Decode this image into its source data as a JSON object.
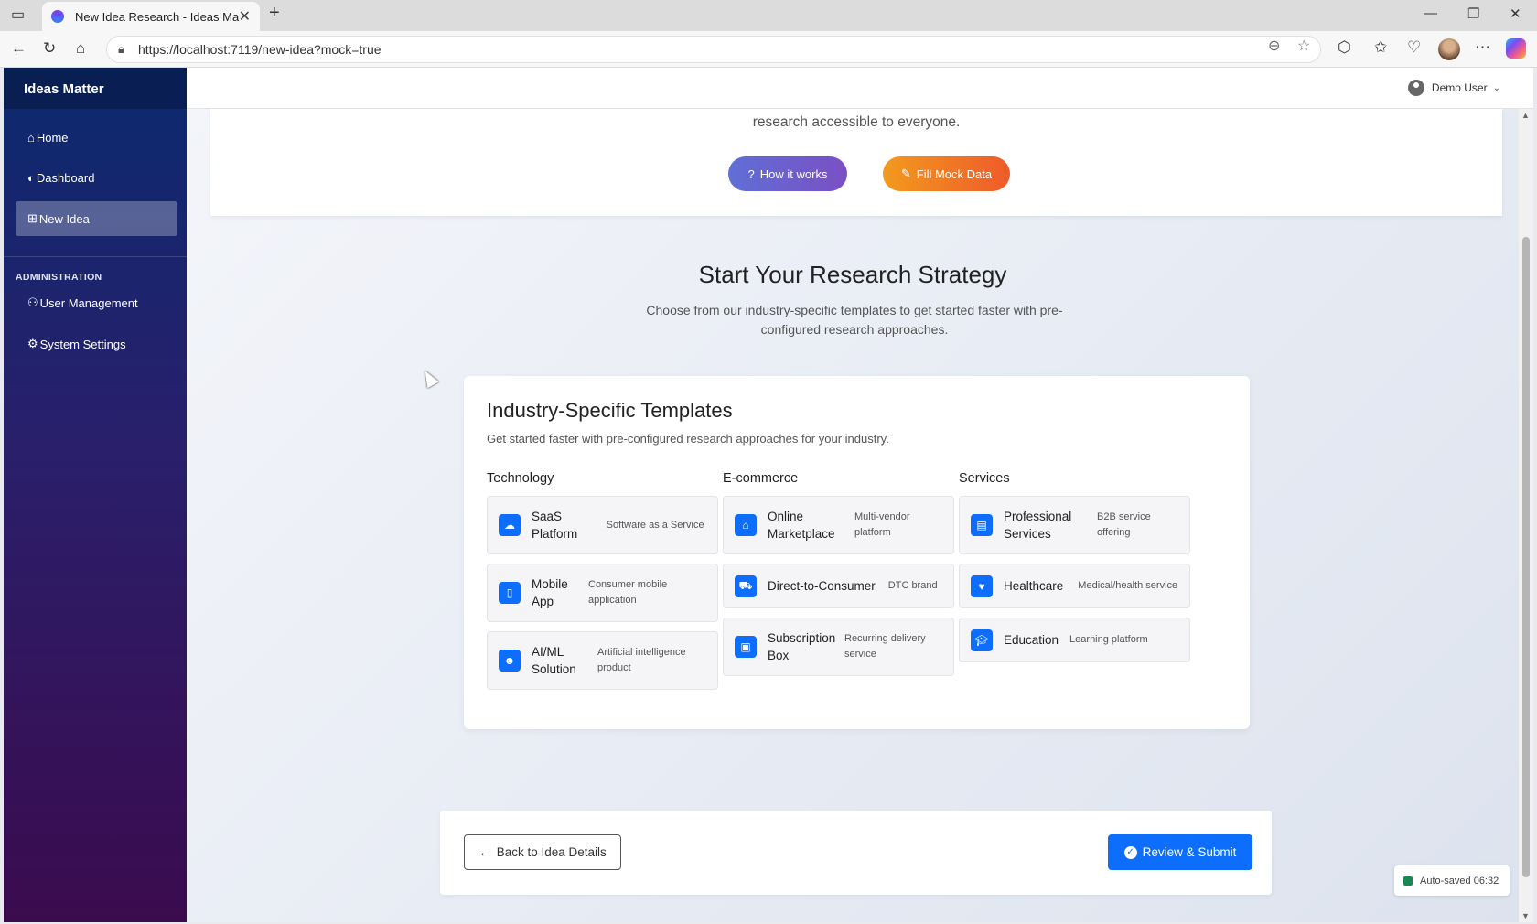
{
  "browser": {
    "tab_title": "New Idea Research - Ideas Matter",
    "url_host": "https://localhost",
    "url_rest": ":7119/new-idea?mock=true"
  },
  "app": {
    "brand": "Ideas Matter",
    "user_name": "Demo User"
  },
  "sidebar": {
    "items": [
      {
        "label": "Home",
        "icon": "home-icon"
      },
      {
        "label": "Dashboard",
        "icon": "palette-icon"
      },
      {
        "label": "New Idea",
        "icon": "plus-square-icon",
        "active": true
      }
    ],
    "admin_label": "ADMINISTRATION",
    "admin_items": [
      {
        "label": "User Management",
        "icon": "users-icon"
      },
      {
        "label": "System Settings",
        "icon": "gears-icon"
      }
    ]
  },
  "hero": {
    "text": "research accessible to everyone.",
    "how_label": "How it works",
    "mock_label": "Fill Mock Data"
  },
  "strategy": {
    "title": "Start Your Research Strategy",
    "subtitle": "Choose from our industry-specific templates to get started faster with pre-configured research approaches."
  },
  "templates": {
    "title": "Industry-Specific Templates",
    "subtitle": "Get started faster with pre-configured research approaches for your industry.",
    "columns": [
      {
        "title": "Technology",
        "items": [
          {
            "name": "SaaS Platform",
            "desc": "Software as a Service",
            "icon": "cloud-icon"
          },
          {
            "name": "Mobile App",
            "desc": "Consumer mobile application",
            "icon": "mobile-icon"
          },
          {
            "name": "AI/ML Solution",
            "desc": "Artificial intelligence product",
            "icon": "robot-icon"
          }
        ]
      },
      {
        "title": "E-commerce",
        "items": [
          {
            "name": "Online Marketplace",
            "desc": "Multi-vendor platform",
            "icon": "store-icon"
          },
          {
            "name": "Direct-to-Consumer",
            "desc": "DTC brand",
            "icon": "cart-icon"
          },
          {
            "name": "Subscription Box",
            "desc": "Recurring delivery service",
            "icon": "box-icon"
          }
        ]
      },
      {
        "title": "Services",
        "items": [
          {
            "name": "Professional Services",
            "desc": "B2B service offering",
            "icon": "briefcase-icon"
          },
          {
            "name": "Healthcare",
            "desc": "Medical/health service",
            "icon": "heart-icon"
          },
          {
            "name": "Education",
            "desc": "Learning platform",
            "icon": "graduation-cap-icon"
          }
        ]
      }
    ]
  },
  "footer": {
    "back_label": "Back to Idea Details",
    "submit_label": "Review & Submit"
  },
  "autosave": "Auto-saved 06:32",
  "colors": {
    "primary": "#0d6efd",
    "how_gradient": "#5f6fd6",
    "mock_gradient": "#f29a1e"
  }
}
